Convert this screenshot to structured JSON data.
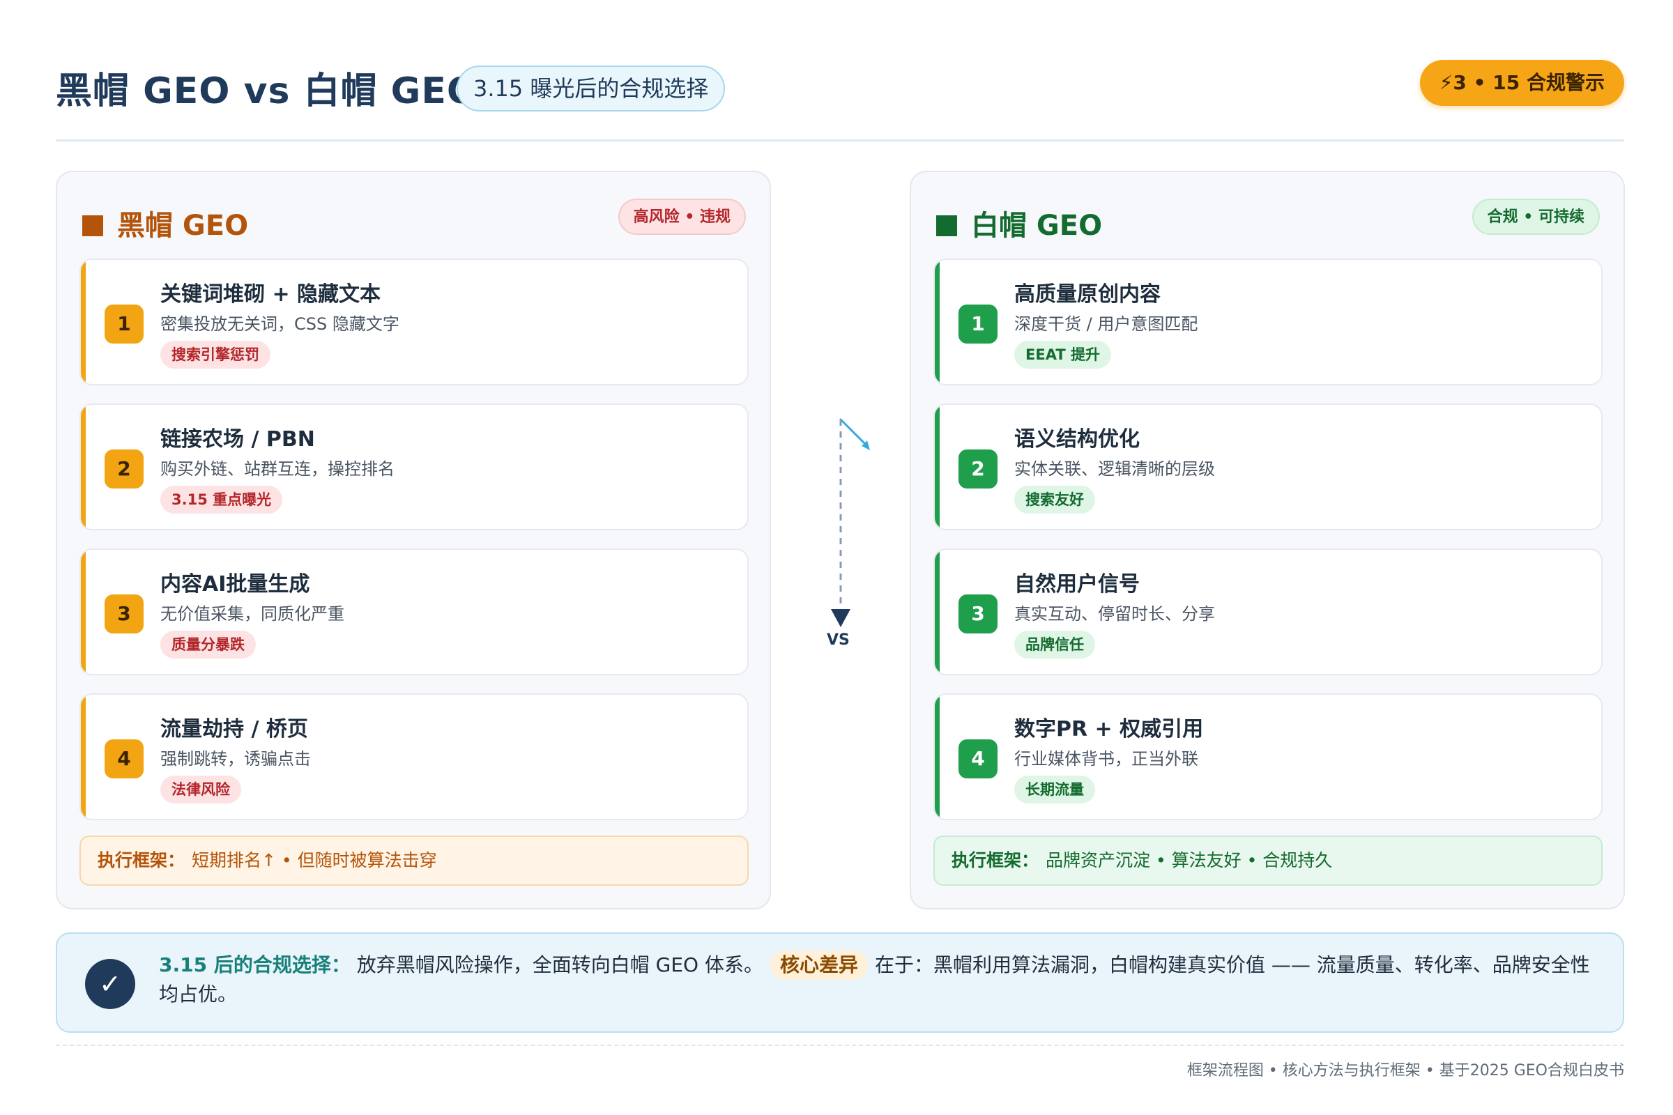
{
  "header": {
    "title": "黑帽 GEO vs 白帽 GEO",
    "subtitle": "3.15 曝光后的合规选择",
    "alert": "⚡3 • 15 合规警示"
  },
  "left_panel": {
    "title": "黑帽 GEO",
    "badge": "高风险 • 违规",
    "items": [
      {
        "num": "1",
        "title": "关键词堆砌 + 隐藏文本",
        "desc": "密集投放无关词，CSS 隐藏文字",
        "tag": "搜索引擎惩罚"
      },
      {
        "num": "2",
        "title": "链接农场 / PBN",
        "desc": "购买外链、站群互连，操控排名",
        "tag": "3.15 重点曝光"
      },
      {
        "num": "3",
        "title": "内容AI批量生成",
        "desc": "无价值采集，同质化严重",
        "tag": "质量分暴跌"
      },
      {
        "num": "4",
        "title": "流量劫持 / 桥页",
        "desc": "强制跳转，诱骗点击",
        "tag": "法律风险"
      }
    ],
    "framework_label": "执行框架：",
    "framework_text": "短期排名↑ • 但随时被算法击穿"
  },
  "right_panel": {
    "title": "白帽 GEO",
    "badge": "合规 • 可持续",
    "items": [
      {
        "num": "1",
        "title": "高质量原创内容",
        "desc": "深度干货 / 用户意图匹配",
        "tag": "EEAT 提升"
      },
      {
        "num": "2",
        "title": "语义结构优化",
        "desc": "实体关联、逻辑清晰的层级",
        "tag": "搜索友好"
      },
      {
        "num": "3",
        "title": "自然用户信号",
        "desc": "真实互动、停留时长、分享",
        "tag": "品牌信任"
      },
      {
        "num": "4",
        "title": "数字PR + 权威引用",
        "desc": "行业媒体背书，正当外联",
        "tag": "长期流量"
      }
    ],
    "framework_label": "执行框架：",
    "framework_text": "品牌资产沉淀 • 算法友好 • 合规持久"
  },
  "connector": {
    "label": "VS"
  },
  "summary": {
    "lead": "3.15 后的合规选择：",
    "text1": "放弃黑帽风险操作，全面转向白帽 GEO 体系。",
    "key": "核心差异",
    "text2": "在于：黑帽利用算法漏洞，白帽构建真实价值 —— 流量质量、转化率、品牌安全性均占优。"
  },
  "footer": "框架流程图 • 核心方法与执行框架 • 基于2025 GEO合规白皮书",
  "colors": {
    "black_hat_accent": "#b4540a",
    "black_hat_number": "#f2a413",
    "white_hat_accent": "#146b2f",
    "white_hat_number": "#1f9e4c",
    "navy": "#1f3a5a",
    "alert": "#f6a516"
  }
}
